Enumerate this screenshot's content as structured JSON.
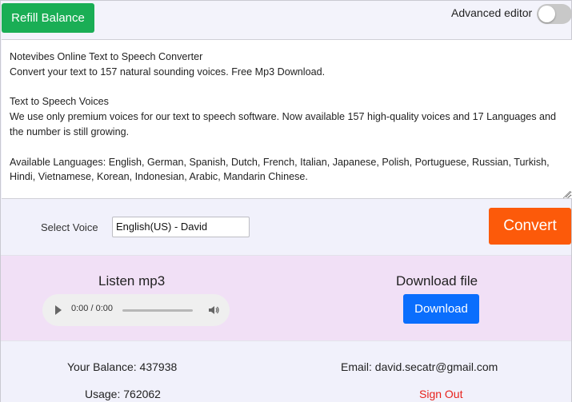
{
  "header": {
    "refill_label": "Refill Balance",
    "advanced_editor_label": "Advanced editor",
    "advanced_editor_on": false
  },
  "editor": {
    "text": "Notevibes Online Text to Speech Converter\nConvert your text to 157 natural sounding voices. Free Mp3 Download.\n\nText to Speech Voices\nWe use only premium voices for our text to speech software. Now available 157 high-quality voices and 17 Languages and the number is still growing.\n\nAvailable Languages: English, German, Spanish, Dutch, French, Italian, Japanese, Polish, Portuguese, Russian, Turkish, Hindi, Vietnamese, Korean, Indonesian, Arabic, Mandarin Chinese."
  },
  "voice": {
    "label": "Select Voice",
    "selected": "English(US) - David",
    "convert_label": "Convert"
  },
  "audio": {
    "listen_title": "Listen mp3",
    "time": "0:00 / 0:00",
    "progress": 0,
    "download_title": "Download file",
    "download_label": "Download"
  },
  "footer": {
    "balance": "Your Balance: 437938",
    "usage": "Usage: 762062",
    "email": "Email: david.secatr@gmail.com",
    "signout_label": "Sign Out"
  },
  "colors": {
    "refill": "#1aae55",
    "convert": "#fc5a0a",
    "download": "#0a6efd",
    "signout": "#e8221c",
    "audio_panel": "#f1e0f6"
  }
}
